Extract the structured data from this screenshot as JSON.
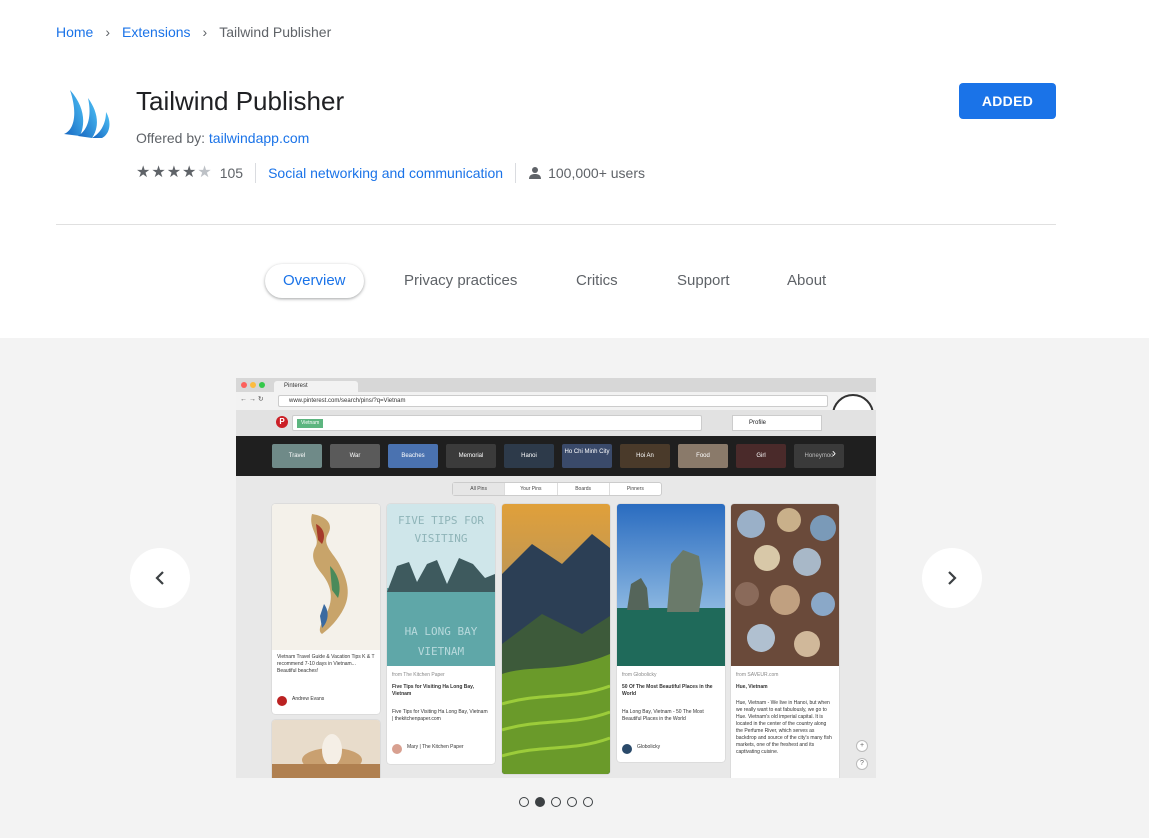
{
  "breadcrumb": {
    "home": "Home",
    "extensions": "Extensions",
    "current": "Tailwind Publisher"
  },
  "extension": {
    "name": "Tailwind Publisher",
    "offered_by_label": "Offered by:",
    "offered_by": "tailwindapp.com",
    "rating": 4,
    "rating_count": "105",
    "category": "Social networking and communication",
    "users": "100,000+ users",
    "action_label": "ADDED"
  },
  "tabs": [
    {
      "label": "Overview",
      "active": true
    },
    {
      "label": "Privacy practices"
    },
    {
      "label": "Critics"
    },
    {
      "label": "Support"
    },
    {
      "label": "About"
    }
  ],
  "gallery": {
    "slide_count": 5,
    "active_slide": 2,
    "screenshot": {
      "tab_title": "Pinterest",
      "url": "www.pinterest.com/search/pins/?q=Vietnam",
      "search_chip": "Vietnam",
      "profile": "Profile",
      "categories": [
        "Travel",
        "War",
        "Beaches",
        "Memorial",
        "Hanoi",
        "Ho Chi Minh City",
        "Hoi An",
        "Food",
        "Girl",
        "Honeymoo"
      ],
      "filters": [
        "All Pins",
        "Your Pins",
        "Boards",
        "Pinners"
      ],
      "pins": [
        {
          "caption": "Vietnam Travel Guide & Vacation Tips K & T recommend 7-10 days in Vietnam... Beautiful beaches!",
          "user": "Andrew Evans"
        },
        {
          "overlay_top": "FIVE TIPS FOR VISITING",
          "overlay_bottom": "HA LONG BAY VIETNAM",
          "source": "from The Kitchen Paper",
          "title": "Five Tips for Visiting Ha Long Bay, Vietnam",
          "caption": "Five Tips for Visiting Ha Long Bay, Vietnam | thekitchenpaper.com",
          "user": "Mary | The Kitchen Paper"
        },
        {
          "caption": ""
        },
        {
          "source": "from Globolicky",
          "title": "50 Of The Most Beautiful Places in the World",
          "caption": "Ha Long Bay, Vietnam - 50 The Most Beautiful Places in the World",
          "user": "Globolicky"
        },
        {
          "source": "from SAVEUR.com",
          "title": "Hue, Vietnam",
          "caption": "Hue, Vietnam - We live in Hanoi, but when we really want to eat fabulously, we go to Hue. Vietnam's old imperial capital. It is located in the center of the country along the Perfume River, which serves as backdrop and source of the city's many fish markets, one of the freshest and its captivating cuisine."
        }
      ]
    }
  },
  "colors": {
    "accent": "#1a73e8",
    "gallery_bg": "#f3f3f3"
  }
}
